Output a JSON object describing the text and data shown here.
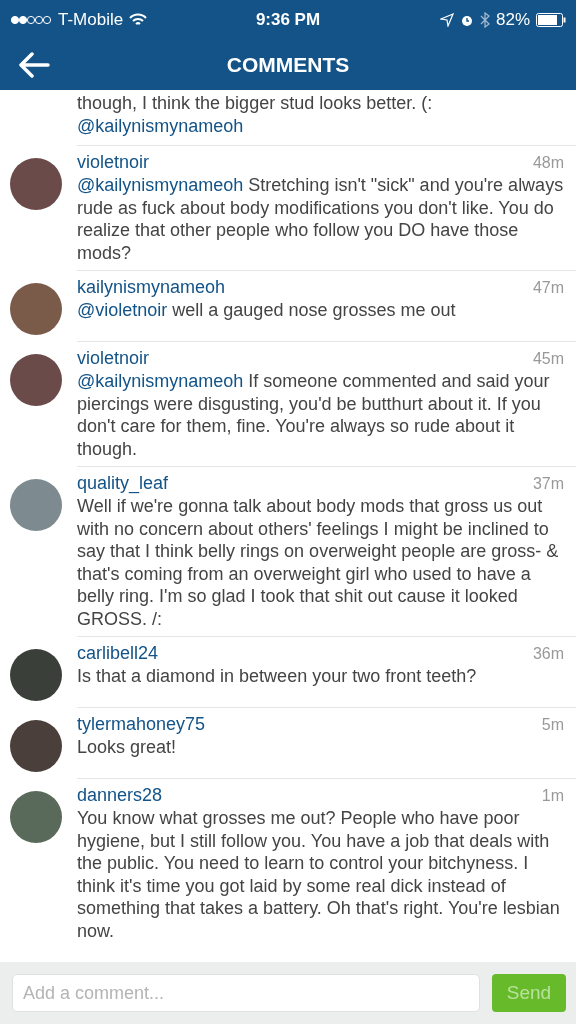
{
  "status_bar": {
    "carrier": "T-Mobile",
    "time": "9:36 PM",
    "battery": "82%"
  },
  "header": {
    "title": "COMMENTS"
  },
  "partial_comment": {
    "parts": [
      {
        "kind": "text",
        "text": "though, I think the bigger stud looks better. (: "
      },
      {
        "kind": "mention",
        "text": "@kailynismynameoh"
      }
    ]
  },
  "comments": [
    {
      "user": "violetnoir",
      "time": "48m",
      "parts": [
        {
          "kind": "mention",
          "text": "@kailynismynameoh"
        },
        {
          "kind": "text",
          "text": " Stretching isn't \"sick\" and you're always rude as fuck about body modifications you don't like. You do realize that other people who follow you DO have those mods?"
        }
      ]
    },
    {
      "user": "kailynismynameoh",
      "time": "47m",
      "parts": [
        {
          "kind": "mention",
          "text": "@violetnoir"
        },
        {
          "kind": "text",
          "text": " well a gauged nose grosses me out"
        }
      ]
    },
    {
      "user": "violetnoir",
      "time": "45m",
      "parts": [
        {
          "kind": "mention",
          "text": "@kailynismynameoh"
        },
        {
          "kind": "text",
          "text": " If someone commented and said your piercings were disgusting, you'd be butthurt about it. If you don't care for them, fine. You're always so rude about it though."
        }
      ]
    },
    {
      "user": "quality_leaf",
      "time": "37m",
      "parts": [
        {
          "kind": "text",
          "text": "Well if we're gonna talk about body mods that gross us out with no concern about others' feelings I might be inclined to say that I think belly rings on overweight people are gross- & that's coming from an overweight girl who used to have a belly ring. I'm so glad I took that shit out cause it looked GROSS. /:"
        }
      ]
    },
    {
      "user": "carlibell24",
      "time": "36m",
      "parts": [
        {
          "kind": "text",
          "text": "Is that a diamond in between your two front teeth?"
        }
      ]
    },
    {
      "user": "tylermahoney75",
      "time": "5m",
      "parts": [
        {
          "kind": "text",
          "text": "Looks great!"
        }
      ]
    },
    {
      "user": "danners28",
      "time": "1m",
      "parts": [
        {
          "kind": "text",
          "text": "You know what grosses me out? People who have poor hygiene, but I still follow you. You have a job that deals with the public. You need to learn to control your bitchyness. I think it's time you got laid by some real dick instead of something that takes a battery. Oh that's right. You're lesbian now."
        }
      ]
    }
  ],
  "composer": {
    "placeholder": "Add a comment...",
    "send": "Send"
  }
}
